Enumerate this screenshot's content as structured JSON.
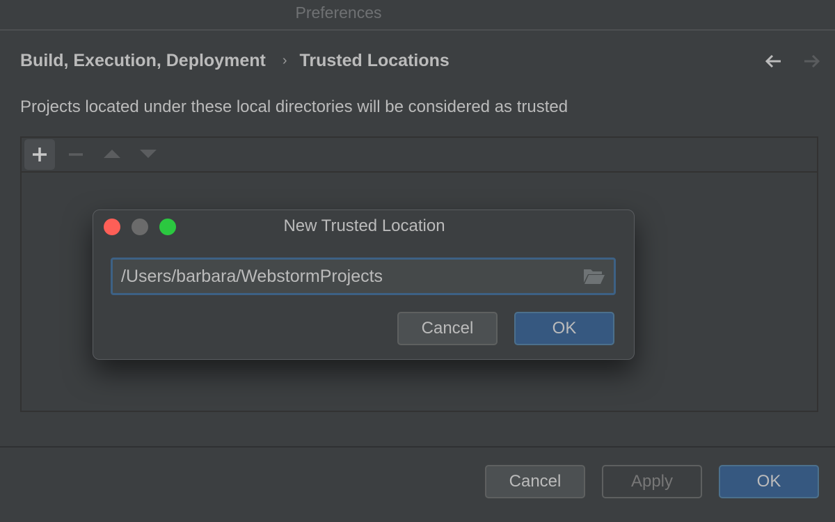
{
  "window": {
    "title": "Preferences"
  },
  "breadcrumb": {
    "parent": "Build, Execution, Deployment",
    "separator": "›",
    "current": "Trusted Locations"
  },
  "nav": {
    "back_icon": "arrow-left-icon",
    "forward_icon": "arrow-right-icon"
  },
  "description": "Projects located under these local directories will be considered as trusted",
  "toolbar": {
    "add_icon": "plus-icon",
    "remove_icon": "minus-icon",
    "up_icon": "triangle-up-icon",
    "down_icon": "triangle-down-icon"
  },
  "dialog": {
    "title": "New Trusted Location",
    "path_value": "/Users/barbara/WebstormProjects",
    "browse_icon": "folder-open-icon",
    "cancel_label": "Cancel",
    "ok_label": "OK",
    "traffic_lights": {
      "close": "#fe5f57",
      "minimize": "#6b6b6b",
      "zoom": "#2bc840"
    }
  },
  "footer": {
    "cancel_label": "Cancel",
    "apply_label": "Apply",
    "ok_label": "OK"
  },
  "colors": {
    "accent": "#365880",
    "focus_border": "#3d6185",
    "background": "#3c3f41"
  }
}
